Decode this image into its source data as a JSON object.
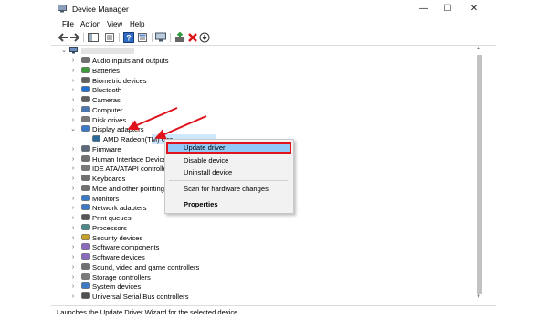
{
  "window": {
    "title": "Device Manager",
    "controls": {
      "minimize": "—",
      "maximize": "☐",
      "close": "✕"
    }
  },
  "menu": [
    "File",
    "Action",
    "View",
    "Help"
  ],
  "tree": {
    "items": [
      {
        "label": "Audio inputs and outputs",
        "icon": "speaker-icon"
      },
      {
        "label": "Batteries",
        "icon": "battery-icon"
      },
      {
        "label": "Biometric devices",
        "icon": "fingerprint-icon"
      },
      {
        "label": "Bluetooth",
        "icon": "bluetooth-icon"
      },
      {
        "label": "Cameras",
        "icon": "camera-icon"
      },
      {
        "label": "Computer",
        "icon": "computer-icon"
      },
      {
        "label": "Disk drives",
        "icon": "disk-icon"
      },
      {
        "label": "Display adapters",
        "icon": "monitor-icon",
        "expanded": true
      },
      {
        "label": "AMD Radeon(TM) Gra",
        "icon": "display-adapter-icon",
        "child": true,
        "selected": true
      },
      {
        "label": "Firmware",
        "icon": "chip-icon"
      },
      {
        "label": "Human Interface Devices",
        "icon": "hid-icon"
      },
      {
        "label": "IDE ATA/ATAPI controllers",
        "icon": "controller-icon"
      },
      {
        "label": "Keyboards",
        "icon": "keyboard-icon"
      },
      {
        "label": "Mice and other pointing",
        "icon": "mouse-icon"
      },
      {
        "label": "Monitors",
        "icon": "monitor-icon"
      },
      {
        "label": "Network adapters",
        "icon": "network-icon"
      },
      {
        "label": "Print queues",
        "icon": "printer-icon"
      },
      {
        "label": "Processors",
        "icon": "cpu-icon"
      },
      {
        "label": "Security devices",
        "icon": "security-icon"
      },
      {
        "label": "Software components",
        "icon": "component-icon"
      },
      {
        "label": "Software devices",
        "icon": "component-icon"
      },
      {
        "label": "Sound, video and game controllers",
        "icon": "speaker-icon"
      },
      {
        "label": "Storage controllers",
        "icon": "storage-icon"
      },
      {
        "label": "System devices",
        "icon": "system-icon"
      },
      {
        "label": "Universal Serial Bus controllers",
        "icon": "usb-icon"
      }
    ]
  },
  "context_menu": {
    "items": [
      "Update driver",
      "Disable device",
      "Uninstall device",
      "Scan for hardware changes",
      "Properties"
    ]
  },
  "status_bar": "Launches the Update Driver Wizard for the selected device.",
  "colors": {
    "highlight_border": "#e0131d",
    "highlight_fill": "#91c9f7",
    "arrow": "#e0131d",
    "selection": "#cde8ff"
  }
}
